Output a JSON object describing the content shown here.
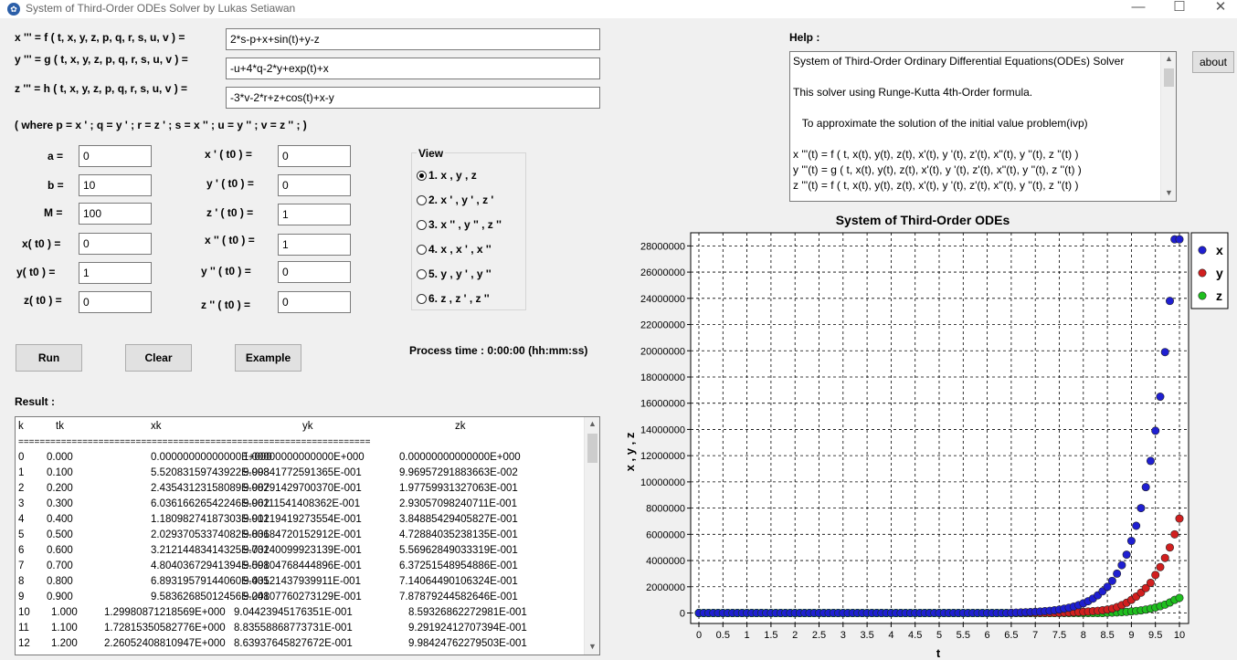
{
  "window": {
    "title": "System of Third-Order ODEs Solver by Lukas Setiawan"
  },
  "equations": {
    "x_label": "x ''' = f ( t, x, y, z, p, q, r, s, u, v ) =",
    "x_value": "2*s-p+x+sin(t)+y-z",
    "y_label": "y ''' = g ( t, x, y, z, p, q, r, s, u, v ) =",
    "y_value": "-u+4*q-2*y+exp(t)+x",
    "z_label": "z ''' = h ( t, x, y, z, p, q, r, s, u, v ) =",
    "z_value": "-3*v-2*r+z+cos(t)+x-y",
    "where_note": "( where p = x ' ; q = y ' ;  r = z ' ; s = x '' ;  u = y '' ; v = z '' ; )"
  },
  "params": [
    {
      "label": "a =",
      "value": "0"
    },
    {
      "label": "b =",
      "value": "10"
    },
    {
      "label": "M =",
      "value": "100"
    },
    {
      "label": "x( t0 ) =",
      "value": "0"
    },
    {
      "label": "y( t0 ) =",
      "value": "1"
    },
    {
      "label": "z( t0 ) =",
      "value": "0"
    }
  ],
  "derivs": [
    {
      "label": "x ' ( t0 ) =",
      "value": "0"
    },
    {
      "label": "y ' ( t0 ) =",
      "value": "0"
    },
    {
      "label": "z ' ( t0 ) =",
      "value": "1"
    },
    {
      "label": "x '' ( t0 ) =",
      "value": "1"
    },
    {
      "label": "y '' ( t0 ) =",
      "value": "0"
    },
    {
      "label": "z '' ( t0 ) =",
      "value": "0"
    }
  ],
  "view": {
    "title": "View",
    "options": [
      "1. x , y , z",
      "2. x ' , y ' , z '",
      "3. x '' , y '' , z ''",
      "4. x , x ' , x ''",
      "5. y , y ' , y ''",
      "6. z , z ' , z ''"
    ],
    "selected_index": 0
  },
  "buttons": {
    "run": "Run",
    "clear": "Clear",
    "example": "Example",
    "about": "about"
  },
  "process_time": "Process time : 0:00:00 (hh:mm:ss)",
  "result": {
    "title": "Result :",
    "headers": [
      "k",
      "tk",
      "xk",
      "yk",
      "zk"
    ],
    "separator": "==================================================================",
    "rows": [
      [
        "0",
        "0.000",
        "0.00000000000000E+000",
        "1.00000000000000E+000",
        "0.00000000000000E+000"
      ],
      [
        "1",
        "0.100",
        "5.52083159743922E-003",
        "9.99841772591365E-001",
        "9.96957291883663E-002"
      ],
      [
        "2",
        "0.200",
        "2.43543123158089E-002",
        "9.98791429700370E-001",
        "1.97759931327063E-001"
      ],
      [
        "3",
        "0.300",
        "6.03616626542246E-002",
        "9.96111541408362E-001",
        "2.93057098240711E-001"
      ],
      [
        "4",
        "0.400",
        "1.18098274187303E-001",
        "9.91219419273554E-001",
        "3.84885429405827E-001"
      ],
      [
        "5",
        "0.500",
        "2.02937053374082E-001",
        "9.83684720152912E-001",
        "4.72884035238135E-001"
      ],
      [
        "6",
        "0.600",
        "3.21214483414325E-001",
        "9.73240099923139E-001",
        "5.56962849033319E-001"
      ],
      [
        "7",
        "0.700",
        "4.80403672941394E-001",
        "9.59804768444896E-001",
        "6.37251548954886E-001"
      ],
      [
        "8",
        "0.800",
        "6.89319579144060E-001",
        "9.43521437939911E-001",
        "7.14064490106324E-001"
      ],
      [
        "9",
        "0.900",
        "9.58362685012456E-001",
        "9.24807760273129E-001",
        "7.87879244582646E-001"
      ],
      [
        "10",
        "1.000",
        "1.29980871218569E+000",
        "9.04423945176351E-001",
        "8.59326862272981E-001"
      ],
      [
        "11",
        "1.100",
        "1.72815350582776E+000",
        "8.83558868773731E-001",
        "9.29192412707394E-001"
      ],
      [
        "12",
        "1.200",
        "2.26052408810947E+000",
        "8.63937645827672E-001",
        "9.98424762279503E-001"
      ]
    ]
  },
  "help": {
    "title": "Help :",
    "lines": [
      "System of Third-Order Ordinary Differential Equations(ODEs) Solver",
      "",
      "This solver using Runge-Kutta 4th-Order formula.",
      "",
      "   To approximate the solution of the initial value problem(ivp)",
      "",
      "x '''(t) = f ( t, x(t), y(t), z(t), x'(t), y '(t), z'(t), x''(t), y ''(t), z ''(t) )",
      "y '''(t) = g ( t, x(t), y(t), z(t), x'(t), y '(t), z'(t), x''(t), y ''(t), z ''(t) )",
      "z '''(t) = f ( t, x(t), y(t), z(t), x'(t), y '(t), z'(t), x''(t), y ''(t), z ''(t) )"
    ]
  },
  "chart_data": {
    "type": "scatter",
    "title": "System of Third-Order ODEs",
    "xlabel": "t",
    "ylabel": "x , y , z",
    "xlim": [
      0,
      10
    ],
    "ylim": [
      -800000,
      29000000
    ],
    "xticks": [
      "0",
      "0.5",
      "1",
      "1.5",
      "2",
      "2.5",
      "3",
      "3.5",
      "4",
      "4.5",
      "5",
      "5.5",
      "6",
      "6.5",
      "7",
      "7.5",
      "8",
      "8.5",
      "9",
      "9.5",
      "10"
    ],
    "yticks": [
      0,
      2000000,
      4000000,
      6000000,
      8000000,
      10000000,
      12000000,
      14000000,
      16000000,
      18000000,
      20000000,
      22000000,
      24000000,
      26000000,
      28000000
    ],
    "grid": true,
    "legend_position": "right",
    "series": [
      {
        "name": "x",
        "color": "#1f1fd1",
        "x": [
          6.5,
          6.6,
          6.7,
          6.8,
          6.9,
          7.0,
          7.1,
          7.2,
          7.3,
          7.4,
          7.5,
          7.6,
          7.7,
          7.8,
          7.9,
          8.0,
          8.1,
          8.2,
          8.3,
          8.4,
          8.5,
          8.6,
          8.7,
          8.8,
          8.9,
          9.0,
          9.1,
          9.2,
          9.3,
          9.4,
          9.5,
          9.6,
          9.7,
          9.8,
          9.9,
          10.0
        ],
        "values": [
          20000,
          30000,
          40000,
          55000,
          70000,
          90000,
          110000,
          140000,
          170000,
          210000,
          260000,
          330000,
          400000,
          490000,
          600000,
          740000,
          900000,
          1100000,
          1350000,
          1650000,
          2000000,
          2450000,
          3000000,
          3650000,
          4450000,
          5500000,
          6650000,
          8000000,
          9600000,
          11600000,
          13900000,
          16500000,
          19900000,
          23800000,
          28500000,
          28500000
        ]
      },
      {
        "name": "y",
        "color": "#d11f1f",
        "x": [
          7.5,
          7.6,
          7.7,
          7.8,
          7.9,
          8.0,
          8.1,
          8.2,
          8.3,
          8.4,
          8.5,
          8.6,
          8.7,
          8.8,
          8.9,
          9.0,
          9.1,
          9.2,
          9.3,
          9.4,
          9.5,
          9.6,
          9.7,
          9.8,
          9.9,
          10.0
        ],
        "values": [
          20000,
          30000,
          40000,
          55000,
          70000,
          90000,
          110000,
          140000,
          170000,
          210000,
          260000,
          330000,
          450000,
          600000,
          780000,
          1000000,
          1250000,
          1550000,
          1900000,
          2300000,
          2900000,
          3500000,
          4200000,
          5000000,
          6000000,
          7200000
        ]
      },
      {
        "name": "z",
        "color": "#1fbf1f",
        "x": [
          8.5,
          8.6,
          8.7,
          8.8,
          8.9,
          9.0,
          9.1,
          9.2,
          9.3,
          9.4,
          9.5,
          9.6,
          9.7,
          9.8,
          9.9,
          10.0
        ],
        "values": [
          20000,
          30000,
          45000,
          65000,
          90000,
          120000,
          160000,
          200000,
          260000,
          330000,
          420000,
          520000,
          640000,
          800000,
          1000000,
          1150000
        ]
      }
    ]
  }
}
